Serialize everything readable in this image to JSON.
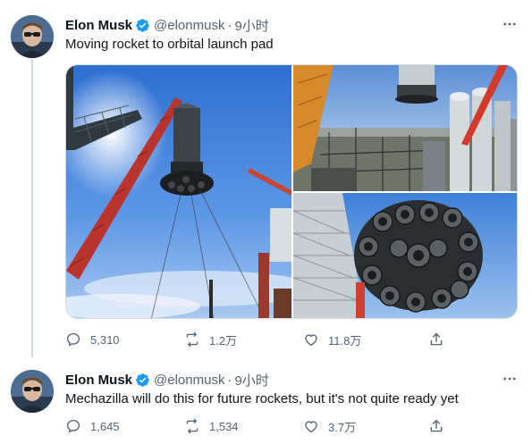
{
  "tweets": [
    {
      "author_name": "Elon Musk",
      "handle": "@elonmusk",
      "separator": "·",
      "time": "9小时",
      "text": "Moving rocket to orbital launch pad",
      "media": [
        {
          "icon": "photo-rocket-crane"
        },
        {
          "icon": "photo-launch-site"
        },
        {
          "icon": "photo-engine-cluster"
        }
      ],
      "stats": {
        "replies": "5,310",
        "retweets": "1.2万",
        "likes": "11.8万"
      }
    },
    {
      "author_name": "Elon Musk",
      "handle": "@elonmusk",
      "separator": "·",
      "time": "9小时",
      "text": "Mechazilla will do this for future rockets, but it's not quite ready yet",
      "stats": {
        "replies": "1,645",
        "retweets": "1,534",
        "likes": "3.7万"
      }
    }
  ],
  "colors": {
    "verified": "#1d9bf0",
    "secondary_text": "#536471",
    "thread_line": "#cfd9de"
  },
  "icons": {
    "verified": "verified-badge-icon",
    "more": "more-options-icon",
    "reply": "reply-icon",
    "retweet": "retweet-icon",
    "like": "heart-icon",
    "share": "share-icon"
  }
}
